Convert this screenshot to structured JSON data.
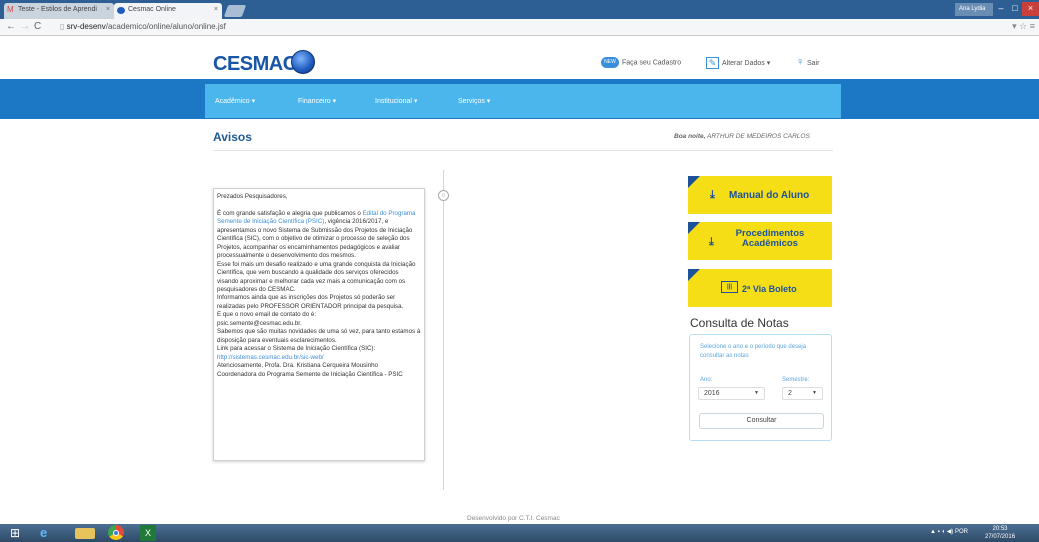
{
  "browser": {
    "tabs": [
      {
        "label": "Teste - Estilos de Aprendi",
        "icon": "gmail-icon"
      },
      {
        "label": "Cesmac Online",
        "icon": "cesmac-globe-icon"
      }
    ],
    "user_badge": "Ana Lydia",
    "url_host": "srv-desenv",
    "url_path": "/academico/online/aluno/online.jsf"
  },
  "header": {
    "logo_text": "CESMAC",
    "links": {
      "cadastro": "Faça seu Cadastro",
      "alterar": "Alterar Dados",
      "sair": "Sair"
    }
  },
  "nav": {
    "items": [
      "Acadêmico",
      "Financeiro",
      "Institucional",
      "Serviços"
    ]
  },
  "main": {
    "title": "Avisos",
    "greeting_prefix": "Boa noite,",
    "greeting_name": "ARTHUR DE MEDEIROS CARLOS"
  },
  "notice": {
    "salutation": "Prezados Pesquisadores,",
    "p1_before_link": "É com grande satisfação e alegria que publicamos o",
    "p1_link": "Edital do Programa Semente de Iniciação Científica (PSIC)",
    "p1_after_link": ", vigência 2016/2017, e apresentamos o novo Sistema de Submissão dos Projetos de Iniciação Científica (SIC), com o objetivo de otimizar o processo de seleção dos Projetos, acompanhar os encaminhamentos pedagógicos e avaliar processualmente o desenvolvimento dos mesmos.",
    "p2": "Esse foi mais um desafio realizado e uma grande conquista da Iniciação Científica, que vem buscando a qualidade dos serviços oferecidos visando aproximar e melhorar cada vez mais a comunicação com os pesquisadores do CESMAC.",
    "p3": "Informamos ainda que as inscrições dos Projetos só poderão ser realizadas pelo PROFESSOR ORIENTADOR principal da pesquisa.",
    "p4": "E que o novo email de contato do é:",
    "p4b": "psic.semente@cesmac.edu.br.",
    "p5": "Sabemos que são muitas novidades de uma só vez, para tanto estamos à disposição para eventuais esclarecimentos.",
    "p6": "Link para acessar o Sistema de Iniciação Científica (SIC):",
    "p6_link": "http://sistemas.cesmac.edu.br/sic-web/",
    "p7": "Atenciosamente, Profa. Dra. Kristiana Cerqueira Mousinho",
    "p8": "Coordenadora do Programa Semente de Iniciação Científica - PSIC"
  },
  "cards": {
    "manual": "Manual do Aluno",
    "proc_line1": "Procedimentos",
    "proc_line2": "Acadêmicos",
    "boleto": "2ª Via Boleto"
  },
  "notas": {
    "title": "Consulta de Notas",
    "hint": "Selecione o ano e o período que deseja consultar as notas",
    "ano_label": "Ano:",
    "semestre_label": "Semestre:",
    "ano_value": "2016",
    "semestre_value": "2",
    "button": "Consultar"
  },
  "footer": "Desenvolvido por C.T.I. Cesmac",
  "taskbar": {
    "tray_lang": "POR",
    "clock_time": "20:53",
    "clock_date": "27/07/2016"
  },
  "colors": {
    "brand_blue": "#1c78c4",
    "nav_light": "#4ab6ec",
    "card_yellow": "#f6de16",
    "title_blue": "#1f5a93"
  }
}
